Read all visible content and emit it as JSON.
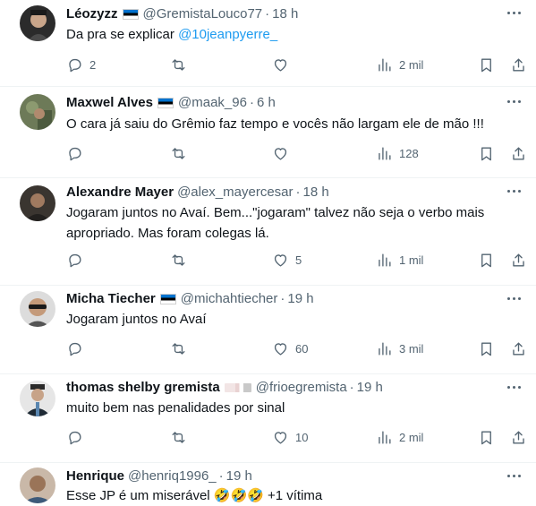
{
  "tweets": [
    {
      "name": "Léozyzz",
      "flag": "ee",
      "handle": "@GremistaLouco77",
      "separator": "·",
      "time": "18 h",
      "text": "Da pra se explicar ",
      "mention": "@10jeanpyerre_",
      "replies": "2",
      "retweets": "",
      "likes": "",
      "views": "2 mil"
    },
    {
      "name": "Maxwel Alves",
      "flag": "ee",
      "handle": "@maak_96",
      "separator": "·",
      "time": "6 h",
      "text": "O cara já saiu do Grêmio faz tempo e vocês não largam ele de mão !!!",
      "replies": "",
      "retweets": "",
      "likes": "",
      "views": "128"
    },
    {
      "name": "Alexandre Mayer",
      "handle": "@alex_mayercesar",
      "separator": "·",
      "time": "18 h",
      "text": "Jogaram juntos no Avaí. Bem...\"jogaram\" talvez não seja o verbo mais apropriado. Mas foram colegas lá.",
      "replies": "",
      "retweets": "",
      "likes": "5",
      "views": "1 mil"
    },
    {
      "name": "Micha Tiecher",
      "flag": "ee",
      "handle": "@michahtiecher",
      "separator": "·",
      "time": "19 h",
      "text": "Jogaram juntos no Avaí",
      "replies": "",
      "retweets": "",
      "likes": "60",
      "views": "3 mil"
    },
    {
      "name": "thomas shelby gremista",
      "flag": "emoji",
      "handle": "@frioegremista",
      "separator": "·",
      "time": "19 h",
      "text": "muito bem nas penalidades por sinal",
      "replies": "",
      "retweets": "",
      "likes": "10",
      "views": "2 mil"
    },
    {
      "name": "Henrique",
      "handle": "@henriq1996_",
      "separator": "·",
      "time": "19 h",
      "text": "Esse JP é um miserável 🤣🤣🤣 +1 vítima",
      "replies": "",
      "retweets": "",
      "likes": "",
      "views": ""
    }
  ],
  "icons": {
    "reply": "reply-icon",
    "retweet": "retweet-icon",
    "like": "heart-icon",
    "views": "views-icon",
    "bookmark": "bookmark-icon",
    "share": "share-icon",
    "more": "more-icon"
  },
  "colors": {
    "text": "#0f1419",
    "secondary": "#536471",
    "link": "#1d9bf0",
    "divider": "#eff3f4"
  }
}
